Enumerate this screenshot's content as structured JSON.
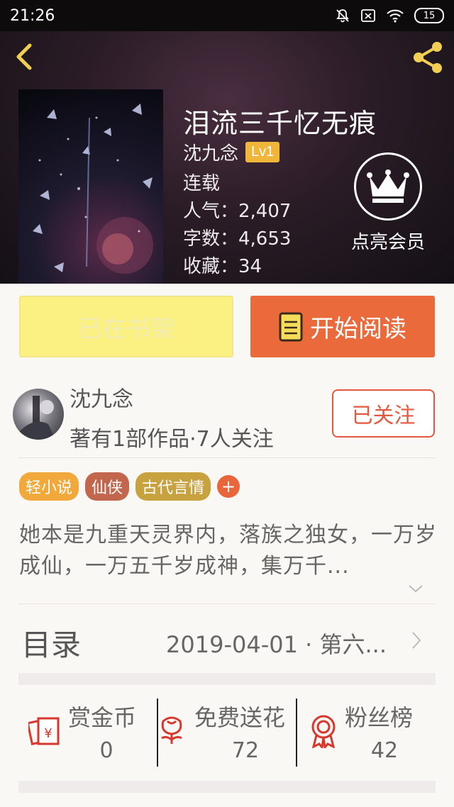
{
  "status_bar": {
    "time": "21:26",
    "battery": "15"
  },
  "book": {
    "title": "泪流三千忆无痕",
    "author": "沈九念",
    "author_level": "Lv1",
    "status": "连载",
    "popularity": "人气：2,407",
    "word_count": "字数：4,653",
    "favorites": "收藏：34"
  },
  "member": {
    "label": "点亮会员"
  },
  "actions": {
    "shelf_label": "已在书架",
    "read_label": "开始阅读"
  },
  "author_card": {
    "name": "沈九念",
    "works": "著有1部作品·7人关注",
    "follow_label": "已关注"
  },
  "tags": [
    {
      "label": "轻小说",
      "color": "#f2a93b"
    },
    {
      "label": "仙侠",
      "color": "#c2664e"
    },
    {
      "label": "古代言情",
      "color": "#c8a23f"
    }
  ],
  "tag_add": "+",
  "synopsis": "她本是九重天灵界内，落族之独女，一万岁成仙，一万五千岁成神，集万千...",
  "toc": {
    "label": "目录",
    "latest": "2019-04-01 · 第六..."
  },
  "stats": [
    {
      "label": "赏金币",
      "value": "0",
      "icon": "red-envelope-coin-icon"
    },
    {
      "label": "免费送花",
      "value": "72",
      "icon": "flower-icon"
    },
    {
      "label": "粉丝榜",
      "value": "42",
      "icon": "award-ribbon-icon"
    }
  ],
  "colors": {
    "accent_orange": "#ea6a3c",
    "accent_red": "#e3593f",
    "shelf_yellow": "#fbf182",
    "badge_gold": "#f0b63a",
    "icon_red": "#d8372e"
  }
}
